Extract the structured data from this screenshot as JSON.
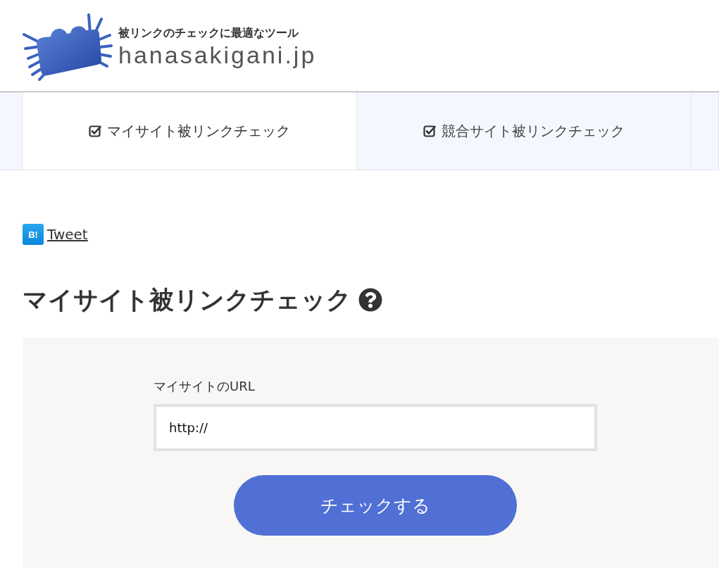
{
  "header": {
    "tagline": "被リンクのチェックに最適なツール",
    "domain": "hanasakigani.jp"
  },
  "tabs": [
    {
      "label": "マイサイト被リンクチェック",
      "selected": true
    },
    {
      "label": "競合サイト被リンクチェック",
      "selected": false
    }
  ],
  "share": {
    "bookmark_badge": "B!",
    "tweet_link": "Tweet"
  },
  "heading": "マイサイト被リンクチェック",
  "form": {
    "label": "マイサイトのURL",
    "url_value": "http://",
    "submit_button": "チェックする"
  }
}
